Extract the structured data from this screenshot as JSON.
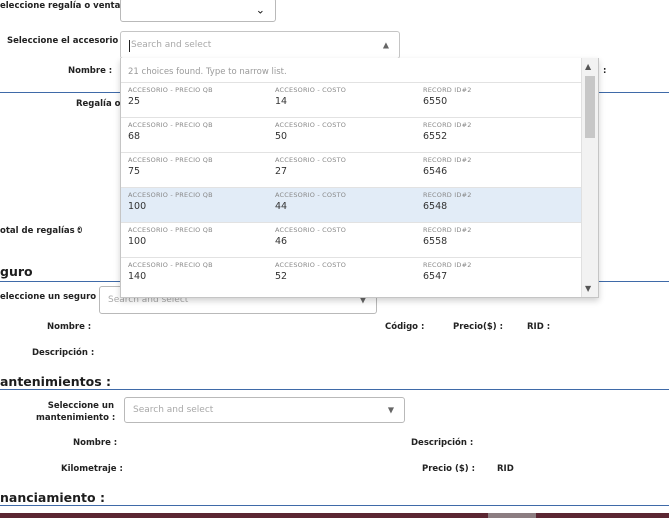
{
  "regalia": {
    "select_label": "eleccione regalía o venta :",
    "accesorio_label": "Seleccione el accesorio :",
    "accesorio_placeholder": "Search and select",
    "nombre_label": "Nombre :",
    "right_partial_label": ":",
    "regalia_label": "Regalía o V",
    "total_label": "otal de regalías :",
    "total_value": "0"
  },
  "dropdown": {
    "header": "21 choices found. Type to narrow list.",
    "col1": "ACCESORIO - PRECIO QB",
    "col2": "ACCESORIO - COSTO",
    "col3": "RECORD ID#2",
    "options": [
      {
        "precio": "25",
        "costo": "14",
        "record": "6550"
      },
      {
        "precio": "68",
        "costo": "50",
        "record": "6552"
      },
      {
        "precio": "75",
        "costo": "27",
        "record": "6546"
      },
      {
        "precio": "100",
        "costo": "44",
        "record": "6548"
      },
      {
        "precio": "100",
        "costo": "46",
        "record": "6558"
      },
      {
        "precio": "140",
        "costo": "52",
        "record": "6547"
      }
    ]
  },
  "seguro": {
    "title": "guro",
    "select_label": "eleccione un seguro :",
    "placeholder": "Search and select",
    "nombre_label": "Nombre :",
    "codigo_label": "Código :",
    "precio_label": "Precio($) :",
    "rid_label": "RID :",
    "descripcion_label": "Descripción :"
  },
  "mantenimientos": {
    "title": "antenimientos :",
    "select_label_1": "Seleccione un",
    "select_label_2": "mantenimiento :",
    "placeholder": "Search and select",
    "nombre_label": "Nombre :",
    "descripcion_label": "Descripción :",
    "kilometraje_label": "Kilometraje :",
    "precio_label": "Precio ($) :",
    "rid_label": "RID"
  },
  "financiamiento": {
    "title": "nanciamiento :"
  },
  "colors": {
    "rule": "#3f6aa8",
    "highlight": "#e2ecf7",
    "bottom_bar": "#5b2632"
  }
}
